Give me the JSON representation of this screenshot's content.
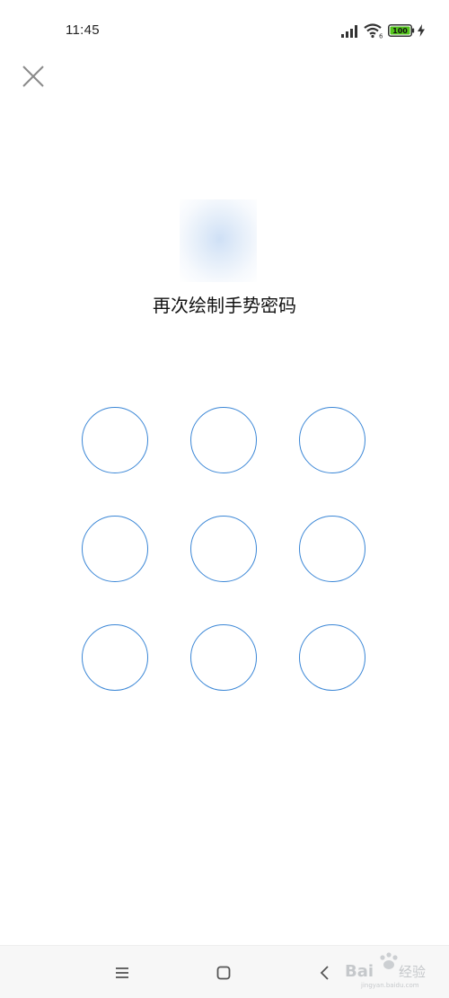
{
  "status_bar": {
    "time": "11:45",
    "battery_level": "100",
    "wifi_label": "6",
    "signal_icon": "signal-bars-icon",
    "wifi_icon": "wifi-icon",
    "battery_icon": "battery-icon",
    "charging_icon": "charging-bolt-icon"
  },
  "header": {
    "close_icon": "close-icon"
  },
  "lock_screen": {
    "prompt": "再次绘制手势密码",
    "avatar_color": "#d7e5f7",
    "dot_color": "#3a86d6",
    "grid": {
      "rows": 3,
      "cols": 3
    }
  },
  "nav_bar": {
    "menu_icon": "menu-icon",
    "home_icon": "home-square-icon",
    "back_icon": "back-chevron-icon"
  },
  "watermark": {
    "brand": "Bai",
    "suffix": "经验",
    "url": "jingyan.baidu.com"
  }
}
